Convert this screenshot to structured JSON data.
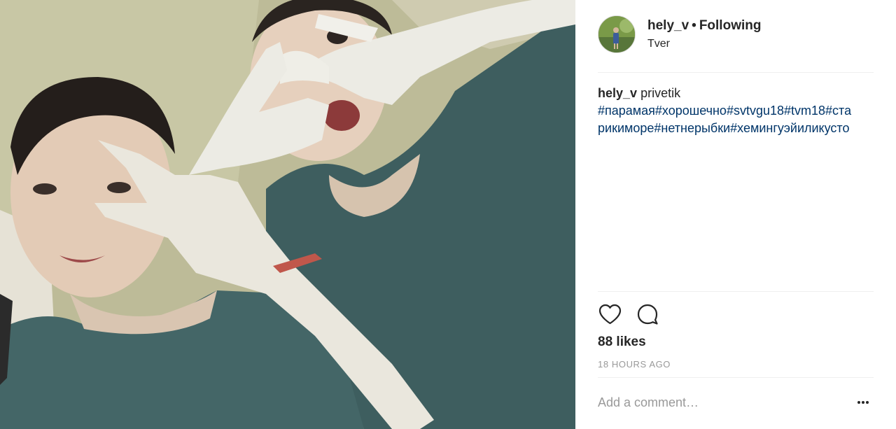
{
  "post": {
    "username": "hely_v",
    "separator": "•",
    "follow_status": "Following",
    "location": "Tver",
    "caption": {
      "username": "hely_v",
      "text": "privetik",
      "hashtags": "#парамая#хорошечно#svtvgu18#tvm18#старикиморе#нетнерыбки#хемингуэйиликусто"
    },
    "likes": "88 likes",
    "timestamp": "18 HOURS AGO",
    "comment_placeholder": "Add a comment…"
  },
  "icons": {
    "like": "heart-outline-icon",
    "comment": "speech-bubble-icon",
    "more": "ellipsis-icon"
  },
  "colors": {
    "text": "#262626",
    "hashtag": "#003569",
    "muted": "#999999",
    "divider": "#efefef",
    "dress": "#3e5e5f"
  }
}
